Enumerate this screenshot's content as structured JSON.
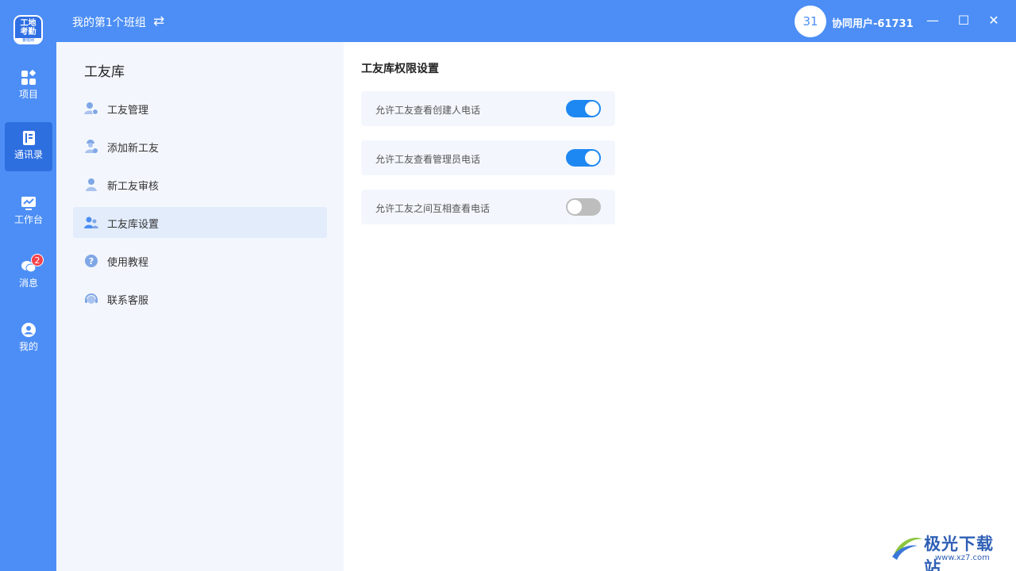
{
  "app": {
    "logo_line1": "工地",
    "logo_line2": "考勤",
    "logo_sub": "鲁班网"
  },
  "nav": {
    "items": [
      {
        "label": "项目",
        "icon": "grid-icon"
      },
      {
        "label": "通讯录",
        "icon": "contacts-book-icon",
        "active": true
      },
      {
        "label": "工作台",
        "icon": "workbench-chart-icon"
      },
      {
        "label": "消息",
        "icon": "chat-bubbles-icon",
        "badge": "2"
      },
      {
        "label": "我的",
        "icon": "user-circle-icon"
      }
    ]
  },
  "topbar": {
    "team_name": "我的第1个班组",
    "switch_icon": "swap-arrows-icon",
    "avatar_text": "31",
    "username": "协同用户-61731",
    "minimize": "—",
    "maximize": "☐",
    "close": "✕"
  },
  "submenu": {
    "title": "工友库",
    "items": [
      {
        "label": "工友管理",
        "icon": "user-settings-icon"
      },
      {
        "label": "添加新工友",
        "icon": "add-worker-icon"
      },
      {
        "label": "新工友审核",
        "icon": "user-icon"
      },
      {
        "label": "工友库设置",
        "icon": "users-gear-icon",
        "active": true
      },
      {
        "label": "使用教程",
        "icon": "help-circle-icon"
      },
      {
        "label": "联系客服",
        "icon": "headset-icon"
      }
    ]
  },
  "content": {
    "title": "工友库权限设置",
    "settings": [
      {
        "label": "允许工友查看创建人电话",
        "enabled": true
      },
      {
        "label": "允许工友查看管理员电话",
        "enabled": true
      },
      {
        "label": "允许工友之间互相查看电话",
        "enabled": false
      }
    ]
  },
  "watermark": {
    "text": "极光下载站",
    "url": "www.xz7.com"
  },
  "colors": {
    "primary": "#4c8ef5",
    "active_nav": "#2e6fe0",
    "toggle_on": "#1e88f2",
    "toggle_off": "#bdbdbd",
    "badge": "#f5434b"
  }
}
